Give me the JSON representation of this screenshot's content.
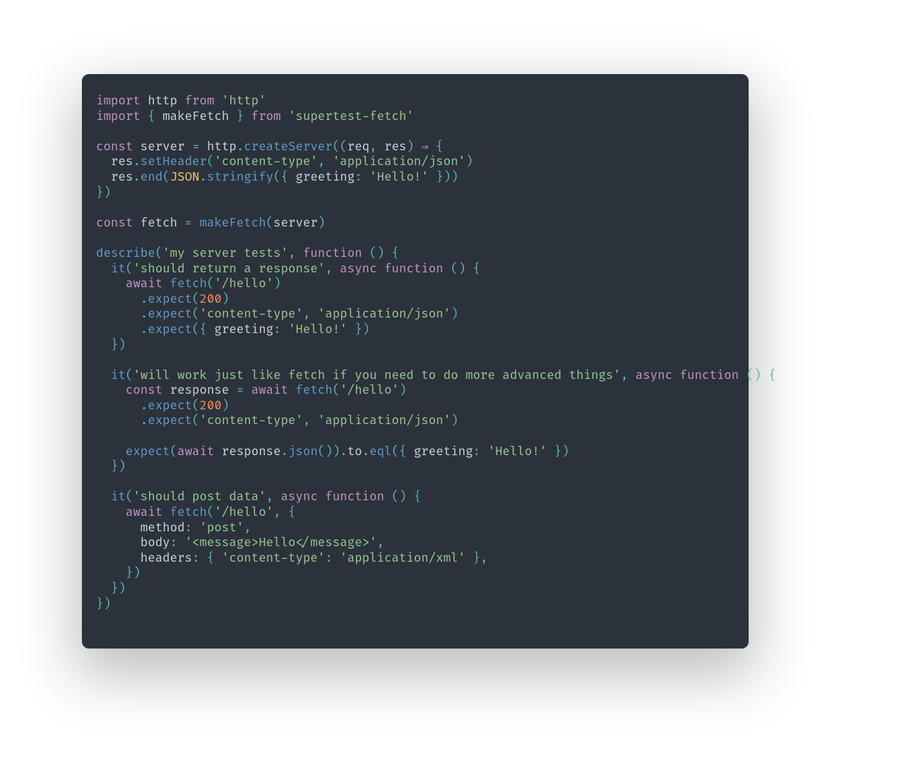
{
  "theme": {
    "background": "#2b323b",
    "keyword": "#c594c5",
    "function": "#6699cc",
    "class": "#fac863",
    "string": "#99c794",
    "number": "#f99157",
    "operator": "#5fb3b3",
    "identifier": "#cdd3de",
    "base": "#c0c5ce"
  },
  "code": {
    "lines": [
      [
        [
          "kw",
          "import"
        ],
        [
          "pun",
          " "
        ],
        [
          "pln",
          "http"
        ],
        [
          "pun",
          " "
        ],
        [
          "kw",
          "from"
        ],
        [
          "pun",
          " "
        ],
        [
          "str",
          "'http'"
        ]
      ],
      [
        [
          "kw",
          "import"
        ],
        [
          "pun",
          " "
        ],
        [
          "op",
          "{ "
        ],
        [
          "pln",
          "makeFetch"
        ],
        [
          "op",
          " }"
        ],
        [
          "pun",
          " "
        ],
        [
          "kw",
          "from"
        ],
        [
          "pun",
          " "
        ],
        [
          "str",
          "'supertest-fetch'"
        ]
      ],
      [],
      [
        [
          "kw",
          "const"
        ],
        [
          "pun",
          " "
        ],
        [
          "pln",
          "server"
        ],
        [
          "pun",
          " "
        ],
        [
          "op",
          "="
        ],
        [
          "pun",
          " "
        ],
        [
          "pln",
          "http"
        ],
        [
          "op",
          "."
        ],
        [
          "fn",
          "createServer"
        ],
        [
          "op",
          "(("
        ],
        [
          "pln",
          "req"
        ],
        [
          "op",
          ","
        ],
        [
          "pun",
          " "
        ],
        [
          "pln",
          "res"
        ],
        [
          "op",
          ")"
        ],
        [
          "pun",
          " "
        ],
        [
          "arrow",
          "⇒"
        ],
        [
          "pun",
          " "
        ],
        [
          "op",
          "{"
        ]
      ],
      [
        [
          "pun",
          "  "
        ],
        [
          "pln",
          "res"
        ],
        [
          "op",
          "."
        ],
        [
          "fn",
          "setHeader"
        ],
        [
          "op",
          "("
        ],
        [
          "str",
          "'content-type'"
        ],
        [
          "op",
          ","
        ],
        [
          "pun",
          " "
        ],
        [
          "str",
          "'application/json'"
        ],
        [
          "op",
          ")"
        ]
      ],
      [
        [
          "pun",
          "  "
        ],
        [
          "pln",
          "res"
        ],
        [
          "op",
          "."
        ],
        [
          "fn",
          "end"
        ],
        [
          "op",
          "("
        ],
        [
          "cls",
          "JSON"
        ],
        [
          "op",
          "."
        ],
        [
          "fn",
          "stringify"
        ],
        [
          "op",
          "({ "
        ],
        [
          "pln",
          "greeting"
        ],
        [
          "op",
          ":"
        ],
        [
          "pun",
          " "
        ],
        [
          "str",
          "'Hello!'"
        ],
        [
          "op",
          " }))"
        ]
      ],
      [
        [
          "op",
          "})"
        ]
      ],
      [],
      [
        [
          "kw",
          "const"
        ],
        [
          "pun",
          " "
        ],
        [
          "pln",
          "fetch"
        ],
        [
          "pun",
          " "
        ],
        [
          "op",
          "="
        ],
        [
          "pun",
          " "
        ],
        [
          "fn",
          "makeFetch"
        ],
        [
          "op",
          "("
        ],
        [
          "pln",
          "server"
        ],
        [
          "op",
          ")"
        ]
      ],
      [],
      [
        [
          "fn",
          "describe"
        ],
        [
          "op",
          "("
        ],
        [
          "str",
          "'my server tests'"
        ],
        [
          "op",
          ","
        ],
        [
          "pun",
          " "
        ],
        [
          "kw",
          "function"
        ],
        [
          "pun",
          " "
        ],
        [
          "op",
          "()"
        ],
        [
          "pun",
          " "
        ],
        [
          "op",
          "{"
        ]
      ],
      [
        [
          "pun",
          "  "
        ],
        [
          "fn",
          "it"
        ],
        [
          "op",
          "("
        ],
        [
          "str",
          "'should return a response'"
        ],
        [
          "op",
          ","
        ],
        [
          "pun",
          " "
        ],
        [
          "kw",
          "async"
        ],
        [
          "pun",
          " "
        ],
        [
          "kw",
          "function"
        ],
        [
          "pun",
          " "
        ],
        [
          "op",
          "()"
        ],
        [
          "pun",
          " "
        ],
        [
          "op",
          "{"
        ]
      ],
      [
        [
          "pun",
          "    "
        ],
        [
          "kw",
          "await"
        ],
        [
          "pun",
          " "
        ],
        [
          "fn",
          "fetch"
        ],
        [
          "op",
          "("
        ],
        [
          "str",
          "'/hello'"
        ],
        [
          "op",
          ")"
        ]
      ],
      [
        [
          "pun",
          "      "
        ],
        [
          "op",
          "."
        ],
        [
          "fn",
          "expect"
        ],
        [
          "op",
          "("
        ],
        [
          "num",
          "200"
        ],
        [
          "op",
          ")"
        ]
      ],
      [
        [
          "pun",
          "      "
        ],
        [
          "op",
          "."
        ],
        [
          "fn",
          "expect"
        ],
        [
          "op",
          "("
        ],
        [
          "str",
          "'content-type'"
        ],
        [
          "op",
          ","
        ],
        [
          "pun",
          " "
        ],
        [
          "str",
          "'application/json'"
        ],
        [
          "op",
          ")"
        ]
      ],
      [
        [
          "pun",
          "      "
        ],
        [
          "op",
          "."
        ],
        [
          "fn",
          "expect"
        ],
        [
          "op",
          "({ "
        ],
        [
          "pln",
          "greeting"
        ],
        [
          "op",
          ":"
        ],
        [
          "pun",
          " "
        ],
        [
          "str",
          "'Hello!'"
        ],
        [
          "op",
          " })"
        ]
      ],
      [
        [
          "pun",
          "  "
        ],
        [
          "op",
          "})"
        ]
      ],
      [],
      [
        [
          "pun",
          "  "
        ],
        [
          "fn",
          "it"
        ],
        [
          "op",
          "("
        ],
        [
          "str",
          "'will work just like fetch if you need to do more advanced things'"
        ],
        [
          "op",
          ","
        ],
        [
          "pun",
          " "
        ],
        [
          "kw",
          "async"
        ],
        [
          "pun",
          " "
        ],
        [
          "kw",
          "function"
        ],
        [
          "pun",
          " "
        ],
        [
          "op",
          "()"
        ],
        [
          "pun",
          " "
        ],
        [
          "op",
          "{"
        ]
      ],
      [
        [
          "pun",
          "    "
        ],
        [
          "kw",
          "const"
        ],
        [
          "pun",
          " "
        ],
        [
          "pln",
          "response"
        ],
        [
          "pun",
          " "
        ],
        [
          "op",
          "="
        ],
        [
          "pun",
          " "
        ],
        [
          "kw",
          "await"
        ],
        [
          "pun",
          " "
        ],
        [
          "fn",
          "fetch"
        ],
        [
          "op",
          "("
        ],
        [
          "str",
          "'/hello'"
        ],
        [
          "op",
          ")"
        ]
      ],
      [
        [
          "pun",
          "      "
        ],
        [
          "op",
          "."
        ],
        [
          "fn",
          "expect"
        ],
        [
          "op",
          "("
        ],
        [
          "num",
          "200"
        ],
        [
          "op",
          ")"
        ]
      ],
      [
        [
          "pun",
          "      "
        ],
        [
          "op",
          "."
        ],
        [
          "fn",
          "expect"
        ],
        [
          "op",
          "("
        ],
        [
          "str",
          "'content-type'"
        ],
        [
          "op",
          ","
        ],
        [
          "pun",
          " "
        ],
        [
          "str",
          "'application/json'"
        ],
        [
          "op",
          ")"
        ]
      ],
      [],
      [
        [
          "pun",
          "    "
        ],
        [
          "fn",
          "expect"
        ],
        [
          "op",
          "("
        ],
        [
          "kw",
          "await"
        ],
        [
          "pun",
          " "
        ],
        [
          "pln",
          "response"
        ],
        [
          "op",
          "."
        ],
        [
          "fn",
          "json"
        ],
        [
          "op",
          "())."
        ],
        [
          "pln",
          "to"
        ],
        [
          "op",
          "."
        ],
        [
          "fn",
          "eql"
        ],
        [
          "op",
          "({ "
        ],
        [
          "pln",
          "greeting"
        ],
        [
          "op",
          ":"
        ],
        [
          "pun",
          " "
        ],
        [
          "str",
          "'Hello!'"
        ],
        [
          "op",
          " })"
        ]
      ],
      [
        [
          "pun",
          "  "
        ],
        [
          "op",
          "})"
        ]
      ],
      [],
      [
        [
          "pun",
          "  "
        ],
        [
          "fn",
          "it"
        ],
        [
          "op",
          "("
        ],
        [
          "str",
          "'should post data'"
        ],
        [
          "op",
          ","
        ],
        [
          "pun",
          " "
        ],
        [
          "kw",
          "async"
        ],
        [
          "pun",
          " "
        ],
        [
          "kw",
          "function"
        ],
        [
          "pun",
          " "
        ],
        [
          "op",
          "()"
        ],
        [
          "pun",
          " "
        ],
        [
          "op",
          "{"
        ]
      ],
      [
        [
          "pun",
          "    "
        ],
        [
          "kw",
          "await"
        ],
        [
          "pun",
          " "
        ],
        [
          "fn",
          "fetch"
        ],
        [
          "op",
          "("
        ],
        [
          "str",
          "'/hello'"
        ],
        [
          "op",
          ","
        ],
        [
          "pun",
          " "
        ],
        [
          "op",
          "{"
        ]
      ],
      [
        [
          "pun",
          "      "
        ],
        [
          "pln",
          "method"
        ],
        [
          "op",
          ":"
        ],
        [
          "pun",
          " "
        ],
        [
          "str",
          "'post'"
        ],
        [
          "op",
          ","
        ]
      ],
      [
        [
          "pun",
          "      "
        ],
        [
          "pln",
          "body"
        ],
        [
          "op",
          ":"
        ],
        [
          "pun",
          " "
        ],
        [
          "str",
          "'<message>Hello</message>'"
        ],
        [
          "op",
          ","
        ]
      ],
      [
        [
          "pun",
          "      "
        ],
        [
          "pln",
          "headers"
        ],
        [
          "op",
          ":"
        ],
        [
          "pun",
          " "
        ],
        [
          "op",
          "{ "
        ],
        [
          "str",
          "'content-type'"
        ],
        [
          "op",
          ":"
        ],
        [
          "pun",
          " "
        ],
        [
          "str",
          "'application/xml'"
        ],
        [
          "op",
          " },"
        ]
      ],
      [
        [
          "pun",
          "    "
        ],
        [
          "op",
          "})"
        ]
      ],
      [
        [
          "pun",
          "  "
        ],
        [
          "op",
          "})"
        ]
      ],
      [
        [
          "op",
          "})"
        ]
      ]
    ]
  }
}
